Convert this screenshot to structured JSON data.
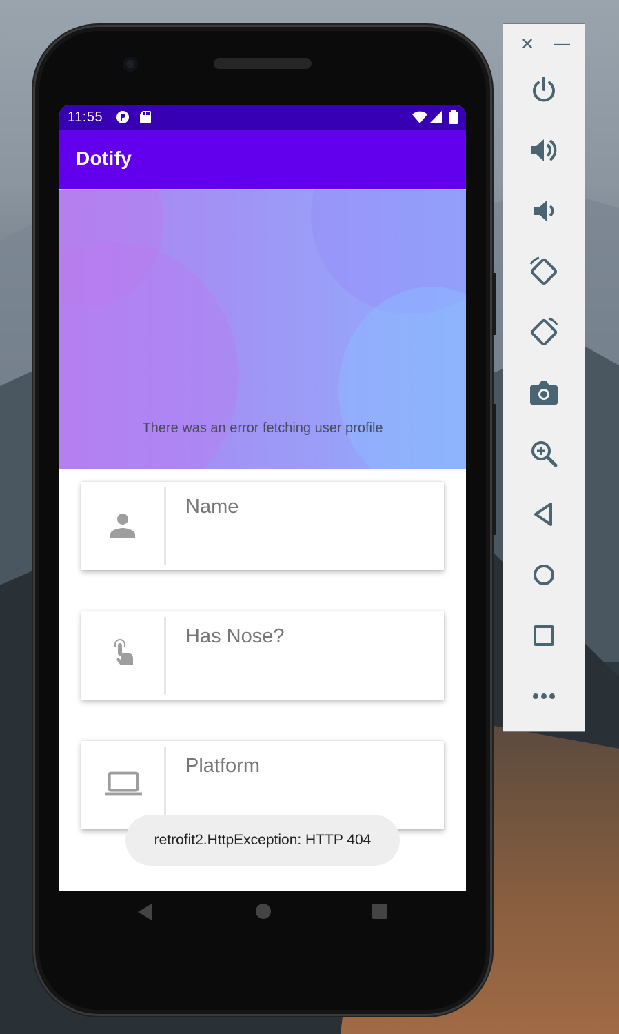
{
  "status_bar": {
    "time": "11:55"
  },
  "app_bar": {
    "title": "Dotify"
  },
  "profile_header": {
    "error_message": "There was an error fetching user profile"
  },
  "profile_fields": [
    {
      "label": "Name",
      "icon": "person-icon"
    },
    {
      "label": "Has Nose?",
      "icon": "touch-icon"
    },
    {
      "label": "Platform",
      "icon": "laptop-icon"
    }
  ],
  "toast": {
    "message": "retrofit2.HttpException: HTTP 404"
  },
  "emulator_controls": [
    "close",
    "minimize",
    "power",
    "volume-up",
    "volume-down",
    "rotate-left",
    "rotate-right",
    "screenshot",
    "zoom",
    "back",
    "home",
    "overview",
    "more"
  ],
  "colors": {
    "status_bar": "#3700b3",
    "app_bar": "#6200ee",
    "gradient_start": "#b083f2",
    "gradient_end": "#8fb0fb",
    "emulator_icon": "#4b6473"
  }
}
